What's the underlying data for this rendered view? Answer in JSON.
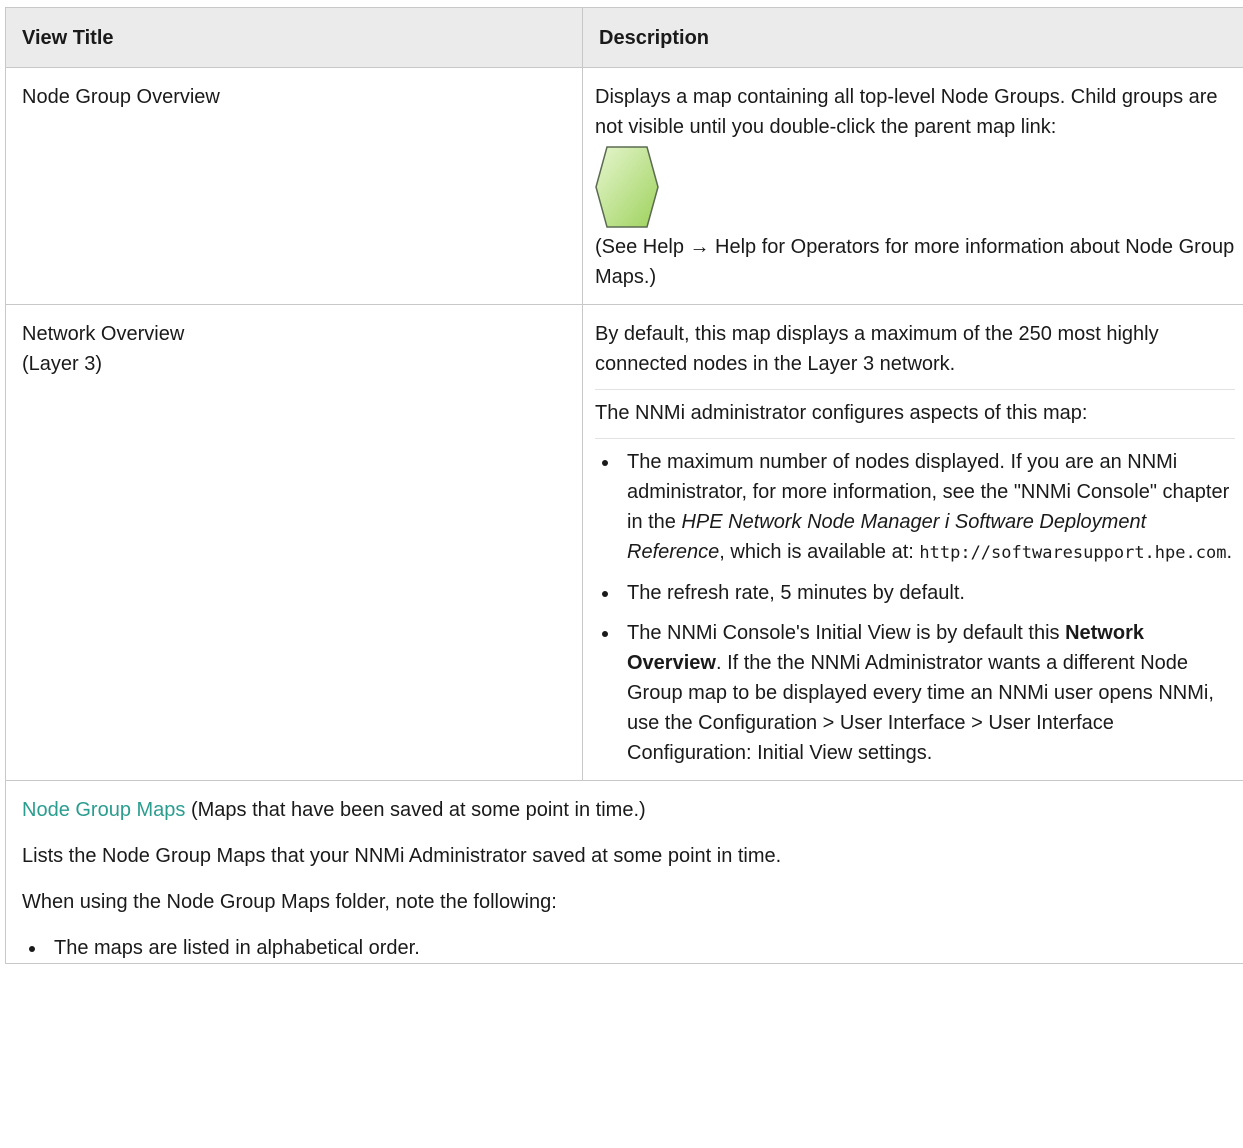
{
  "table": {
    "header": {
      "col1": "View Title",
      "col2": "Description"
    },
    "row1": {
      "title": "Node Group Overview",
      "desc_line": "Displays a map containing all top-level Node Groups. Child groups are not visible until you double-click the parent map link:",
      "help_note": "(See Help → Help for Operators for more information about Node Group Maps.)"
    },
    "row2": {
      "title_line1": "Network Overview",
      "title_line2": "(Layer 3)",
      "desc_p1": "By default, this map displays a maximum of the 250 most highly connected nodes in the Layer 3 network.",
      "desc_p2": "The NNMi administrator configures aspects of this map:",
      "bullet1_pre": "The maximum number of nodes displayed. If you are an NNMi administrator, for more information, see the \"NNMi Console\" chapter in the ",
      "bullet1_italic": "HPE Network Node Manager i Software Deployment Reference",
      "bullet1_mid": ", which is available at: ",
      "bullet1_code": "http://softwaresupport.hpe.com",
      "bullet1_end": ".",
      "bullet2": "The refresh rate, 5 minutes by default.",
      "bullet3_pre": "The NNMi Console's Initial View is by default this ",
      "bullet3_bold": "Network Overview",
      "bullet3_post": ". If the the NNMi Administrator wants a different Node Group map to be displayed every time an NNMi user opens NNMi, use the Configuration > User Interface > User Interface Configuration: Initial View settings."
    },
    "row3": {
      "link": "Node Group Maps",
      "link_note": " (Maps that have been saved at some point in time.)",
      "p2": "Lists the Node Group Maps that your NNMi Administrator saved at some point in time.",
      "p3": "When using the Node Group Maps folder, note the following:",
      "bullet1": "The maps are listed in alphabetical order."
    }
  },
  "colors": {
    "header_bg": "#ebebeb",
    "border": "#c8c8c8",
    "link": "#2a9d8f",
    "hex_fill_light": "#dff3c4",
    "hex_fill_dark": "#9fd45f",
    "hex_stroke": "#5a6b50"
  },
  "icons": {
    "node_group": "node-group-hexagon-icon"
  }
}
